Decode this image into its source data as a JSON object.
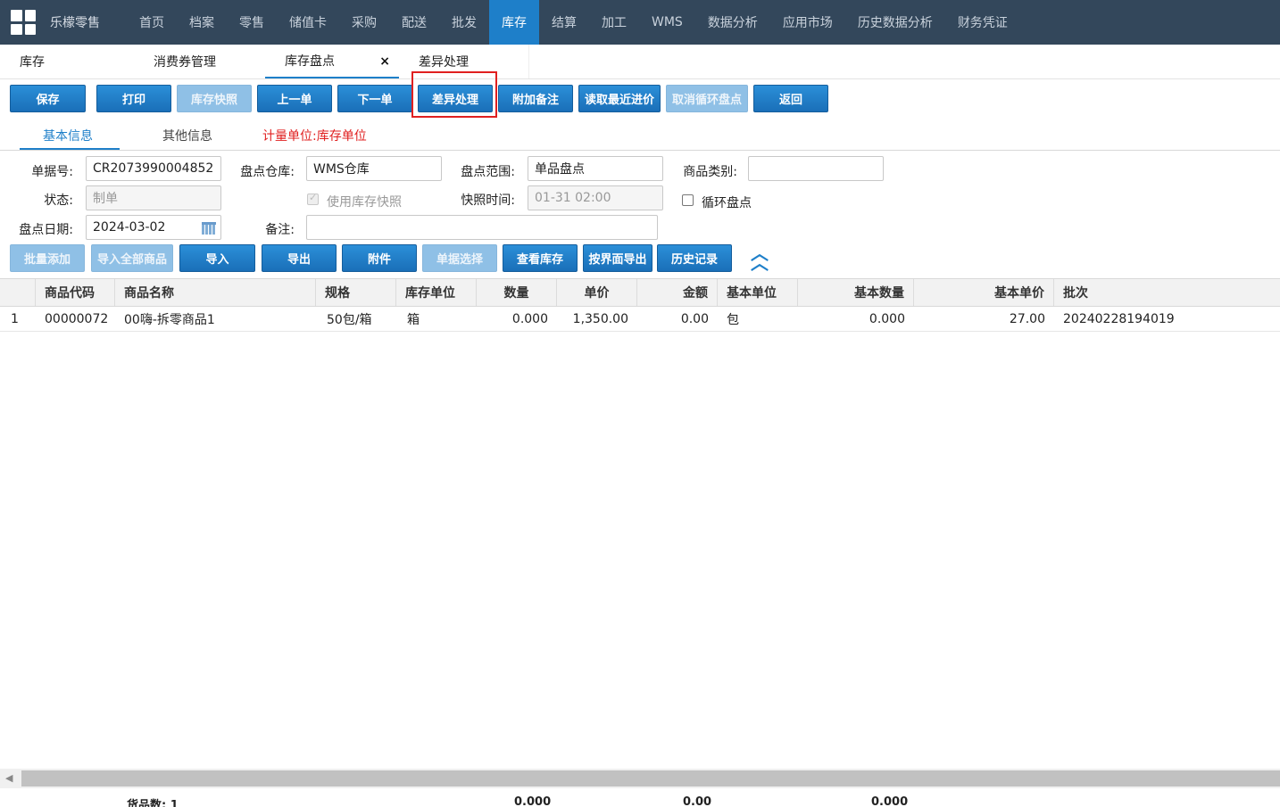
{
  "app": {
    "brand": "乐檬零售"
  },
  "nav": [
    {
      "label": "首页",
      "active": false
    },
    {
      "label": "档案",
      "active": false
    },
    {
      "label": "零售",
      "active": false
    },
    {
      "label": "储值卡",
      "active": false
    },
    {
      "label": "采购",
      "active": false
    },
    {
      "label": "配送",
      "active": false
    },
    {
      "label": "批发",
      "active": false
    },
    {
      "label": "库存",
      "active": true
    },
    {
      "label": "结算",
      "active": false
    },
    {
      "label": "加工",
      "active": false
    },
    {
      "label": "WMS",
      "active": false
    },
    {
      "label": "数据分析",
      "active": false
    },
    {
      "label": "应用市场",
      "active": false
    },
    {
      "label": "历史数据分析",
      "active": false
    },
    {
      "label": "财务凭证",
      "active": false
    }
  ],
  "tabs": {
    "t1": "库存",
    "t2": "消费券管理",
    "t3": "库存盘点",
    "t3_close": "×",
    "t4": "差异处理"
  },
  "toolbar": {
    "save": "保存",
    "print": "打印",
    "snapshot": "库存快照",
    "prev": "上一单",
    "next": "下一单",
    "diff": "差异处理",
    "note": "附加备注",
    "latest_price": "读取最近进价",
    "cancel_cycle": "取消循环盘点",
    "back": "返回"
  },
  "subtabs": {
    "basic": "基本信息",
    "other": "其他信息",
    "unit_note": "计量单位:库存单位"
  },
  "form": {
    "doc_no_label": "单据号:",
    "doc_no": "CR2073990004852",
    "warehouse_label": "盘点仓库:",
    "warehouse": "WMS仓库",
    "scope_label": "盘点范围:",
    "scope": "单品盘点",
    "category_label": "商品类别:",
    "category": "",
    "status_label": "状态:",
    "status": "制单",
    "use_snapshot_label": "使用库存快照",
    "snapshot_time_label": "快照时间:",
    "snapshot_time": "01-31 02:00",
    "cycle_label": "循环盘点",
    "date_label": "盘点日期:",
    "date": "2024-03-02",
    "remark_label": "备注:",
    "remark": ""
  },
  "actions": {
    "batch_add": "批量添加",
    "import_all": "导入全部商品",
    "import": "导入",
    "export": "导出",
    "attach": "附件",
    "doc_select": "单据选择",
    "view_stock": "查看库存",
    "export_view": "按界面导出",
    "history": "历史记录"
  },
  "table": {
    "headers": {
      "code": "商品代码",
      "name": "商品名称",
      "spec": "规格",
      "unit": "库存单位",
      "qty": "数量",
      "price": "单价",
      "amount": "金额",
      "base_unit": "基本单位",
      "base_qty": "基本数量",
      "base_price": "基本单价",
      "batch": "批次"
    },
    "rows": [
      {
        "no": "1",
        "code": "00000072",
        "name": "00嗨-拆零商品1",
        "spec": "50包/箱",
        "unit": "箱",
        "qty": "0.000",
        "price": "1,350.00",
        "amount": "0.00",
        "base_unit": "包",
        "base_qty": "0.000",
        "base_price": "27.00",
        "batch": "20240228194019"
      }
    ]
  },
  "footer": {
    "count": "货品数: 1",
    "qty_total": "0.000",
    "amount_total": "0.00",
    "base_qty_total": "0.000"
  },
  "colors": {
    "nav_bg": "#33475b",
    "accent": "#1e7fc9",
    "warning_text": "#e02020"
  }
}
